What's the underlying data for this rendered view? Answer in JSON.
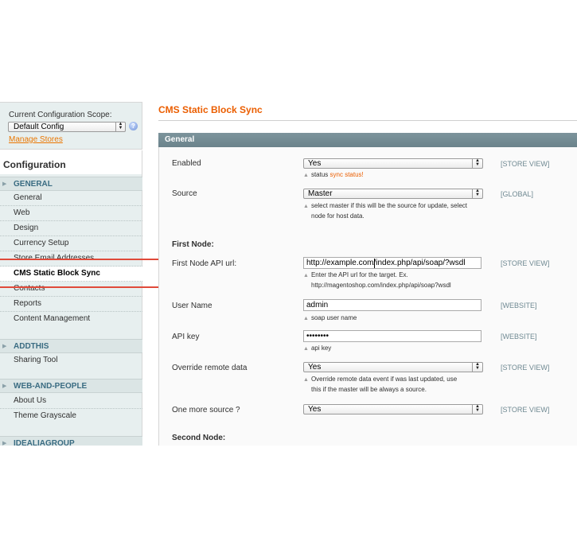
{
  "scope": {
    "label": "Current Configuration Scope:",
    "selected": "Default Config",
    "manage_link": "Manage Stores"
  },
  "sidebar": {
    "title": "Configuration",
    "sections": [
      {
        "label": "GENERAL",
        "items": [
          "General",
          "Web",
          "Design",
          "Currency Setup",
          "Store Email Addresses",
          "CMS Static Block Sync",
          "Contacts",
          "Reports",
          "Content Management"
        ]
      },
      {
        "label": "ADDTHIS",
        "items": [
          "Sharing Tool"
        ]
      },
      {
        "label": "WEB-AND-PEOPLE",
        "items": [
          "About Us",
          "Theme Grayscale"
        ]
      },
      {
        "label": "IDEALIAGROUP",
        "items": []
      }
    ],
    "active_item": "CMS Static Block Sync"
  },
  "main": {
    "title": "CMS Static Block Sync",
    "section_title": "General",
    "fields": {
      "enabled": {
        "label": "Enabled",
        "value": "Yes",
        "scope": "[STORE VIEW]",
        "note": "status",
        "note_warn": "sync status!"
      },
      "source": {
        "label": "Source",
        "value": "Master",
        "scope": "[GLOBAL]",
        "note_line1": "select master if this will be the source for update, select",
        "note_line2": "node for host data."
      },
      "first_node_group": "First Node:",
      "api_url": {
        "label": "First Node API url:",
        "value": "http://example.com/index.php/api/soap/?wsdl",
        "scope": "[STORE VIEW]",
        "note_line1": "Enter the API url for the target. Ex.",
        "note_line2": "http://magentoshop.com/index.php/api/soap?wsdl"
      },
      "user_name": {
        "label": "User Name",
        "value": "admin",
        "scope": "[WEBSITE]",
        "note": "soap user name"
      },
      "api_key": {
        "label": "API key",
        "value": "••••••••",
        "scope": "[WEBSITE]",
        "note": "api key"
      },
      "override": {
        "label": "Override remote data",
        "value": "Yes",
        "scope": "[STORE VIEW]",
        "note_line1": "Override remote data event if was last updated, use",
        "note_line2": "this if the master will be always a source."
      },
      "more_source": {
        "label": "One more source ?",
        "value": "Yes",
        "scope": "[STORE VIEW]"
      },
      "second_node_group": "Second Node:"
    }
  },
  "colors": {
    "accent": "#eb5e00",
    "section_bar": "#6b838b",
    "sidebar_bg": "#e7efef",
    "highlight": "#e04a3a",
    "link": "#ea7601"
  },
  "icons": {
    "select_arrows": "updown-arrows-icon",
    "help": "help-icon",
    "section_toggle": "triangle-right-icon",
    "note_marker": "triangle-up-icon"
  }
}
